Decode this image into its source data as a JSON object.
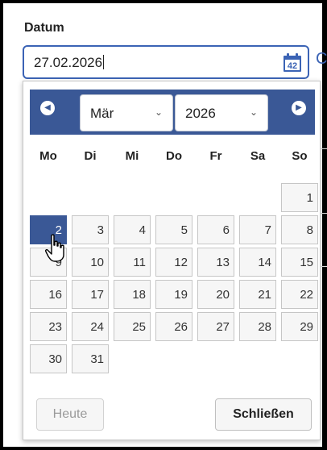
{
  "field": {
    "label": "Datum",
    "value": "27.02.2026"
  },
  "icons": {
    "calendar": "calendar-icon",
    "calendar_number": "42",
    "prev": "chevron-left-icon",
    "next": "chevron-right-icon"
  },
  "outside": {
    "glyph": "C"
  },
  "datepicker": {
    "month": "Mär",
    "year": "2026",
    "select_arrow": "⌄",
    "weekdays": [
      "Mo",
      "Di",
      "Mi",
      "Do",
      "Fr",
      "Sa",
      "So"
    ],
    "weeks": [
      [
        "",
        "",
        "",
        "",
        "",
        "",
        "1"
      ],
      [
        "2",
        "3",
        "4",
        "5",
        "6",
        "7",
        "8"
      ],
      [
        "9",
        "10",
        "11",
        "12",
        "13",
        "14",
        "15"
      ],
      [
        "16",
        "17",
        "18",
        "19",
        "20",
        "21",
        "22"
      ],
      [
        "23",
        "24",
        "25",
        "26",
        "27",
        "28",
        "29"
      ],
      [
        "30",
        "31",
        "",
        "",
        "",
        "",
        ""
      ]
    ],
    "selected_day": "2",
    "today_label": "Heute",
    "close_label": "Schließen"
  },
  "colors": {
    "header": "#3a5896",
    "input_border": "#3b63b5",
    "selected_day": "#3a5896"
  }
}
